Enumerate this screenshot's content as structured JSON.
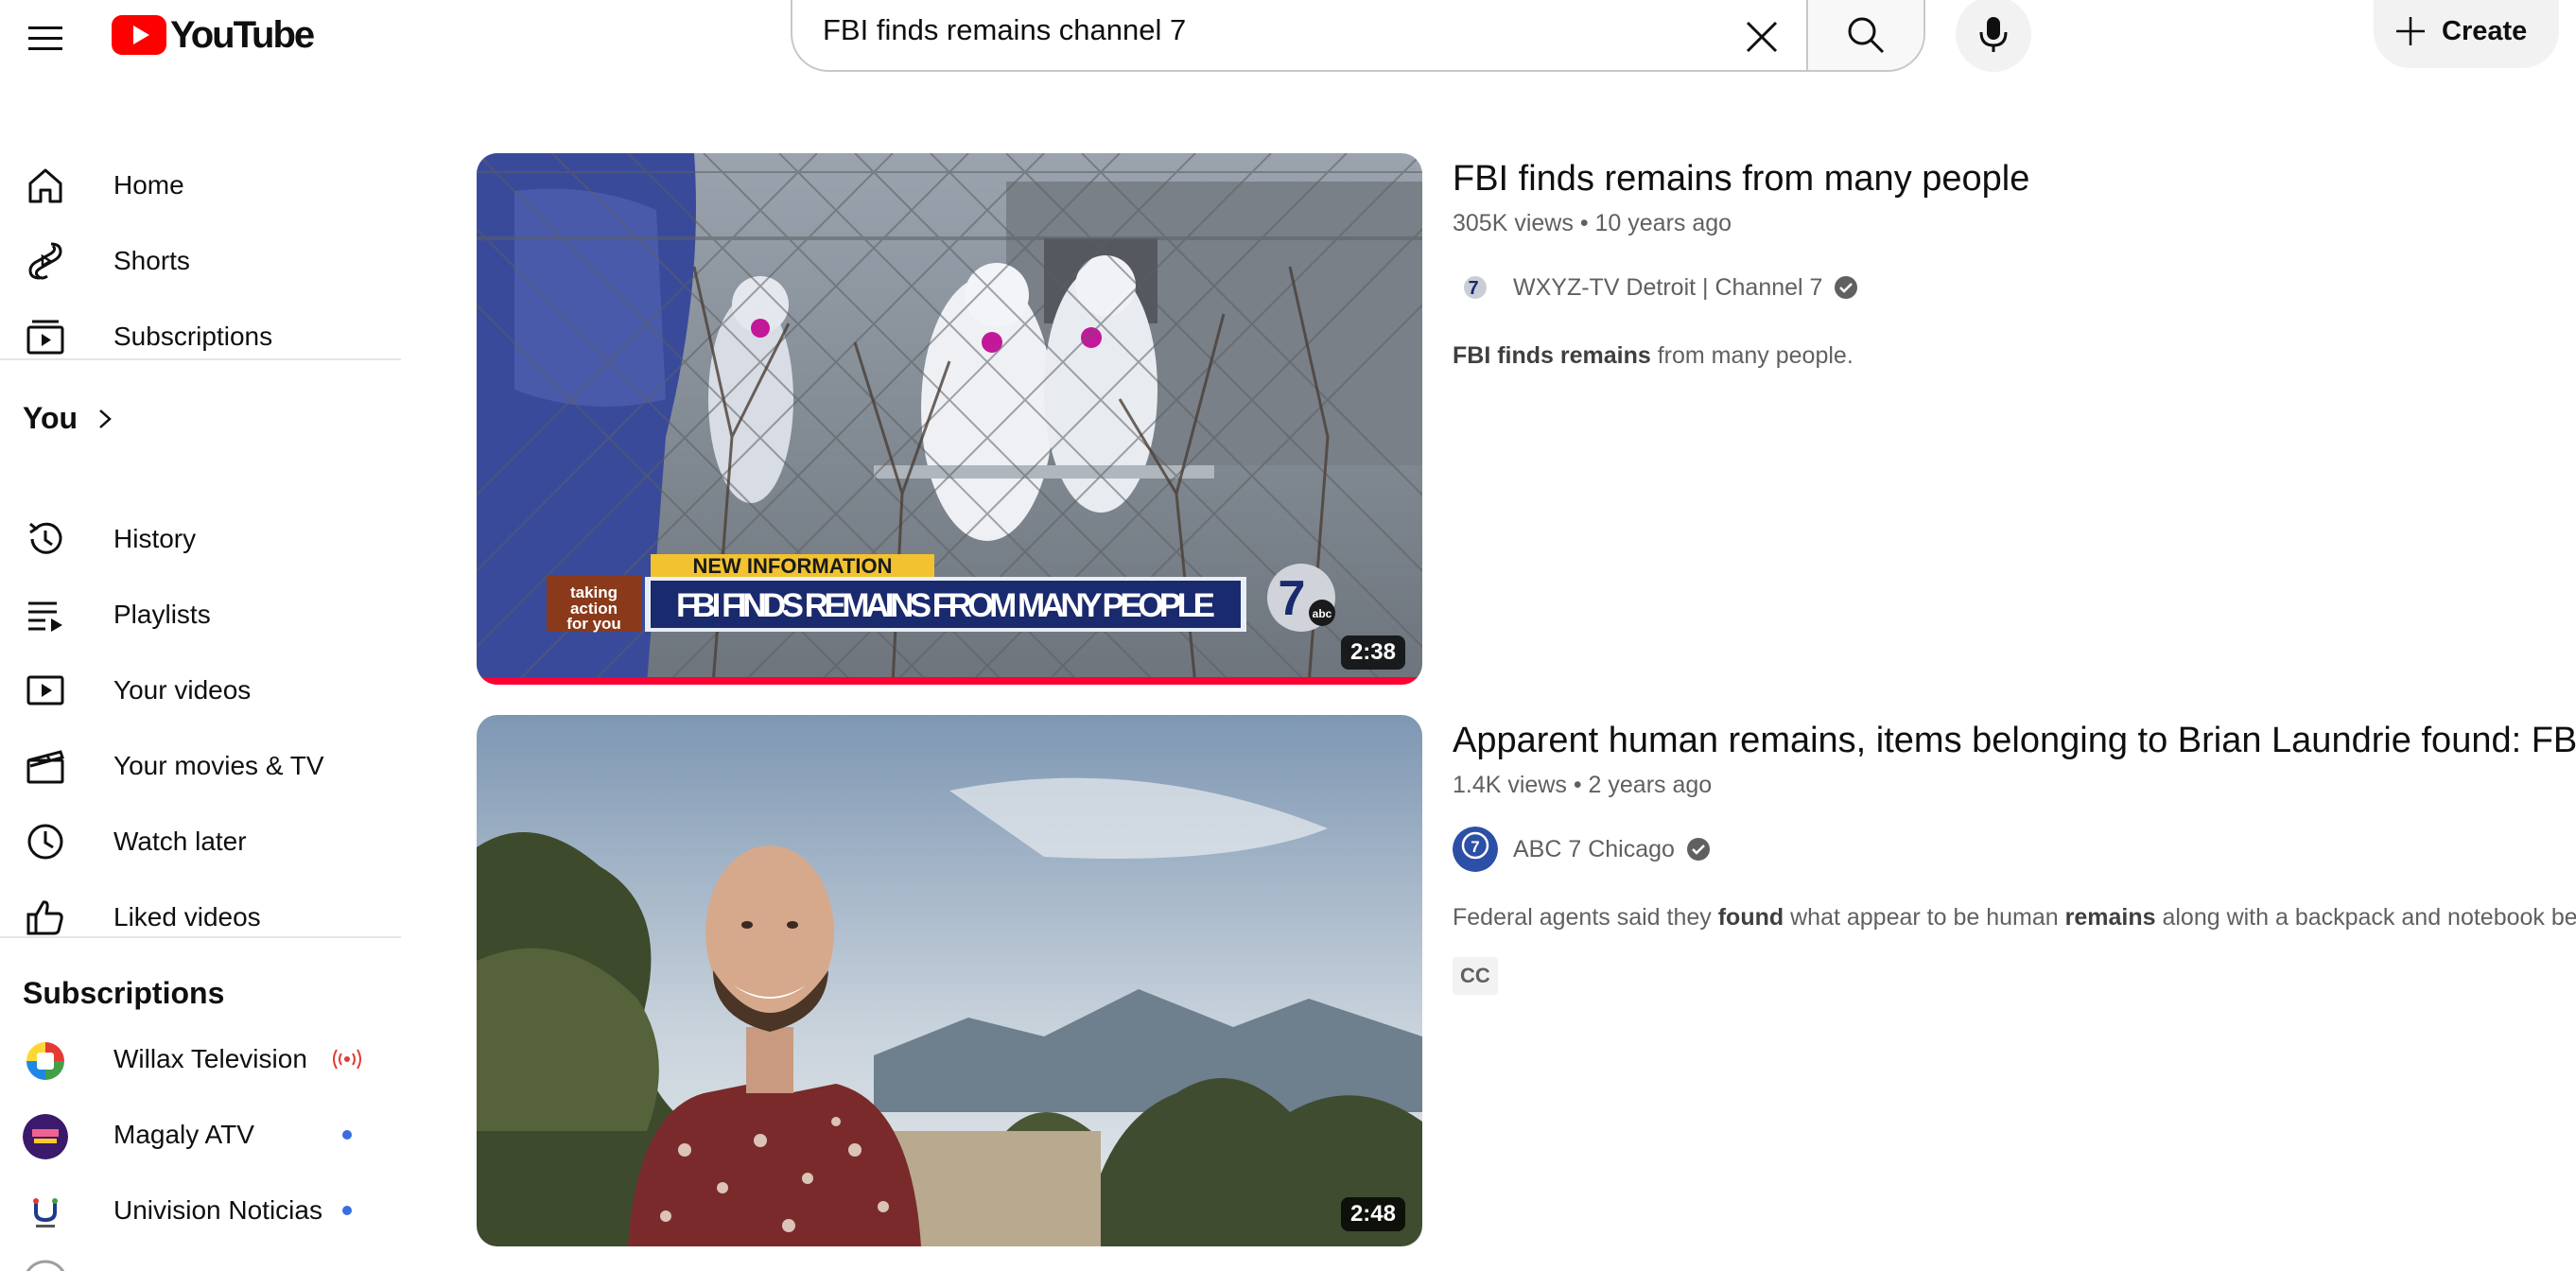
{
  "header": {
    "logo_text": "YouTube",
    "search_value": "FBI finds remains channel 7",
    "create_label": "Create"
  },
  "sidebar": {
    "main_items": [
      {
        "label": "Home",
        "icon": "home-icon"
      },
      {
        "label": "Shorts",
        "icon": "shorts-icon"
      },
      {
        "label": "Subscriptions",
        "icon": "subscriptions-icon"
      }
    ],
    "you_title": "You",
    "you_items": [
      {
        "label": "History",
        "icon": "history-icon"
      },
      {
        "label": "Playlists",
        "icon": "playlists-icon"
      },
      {
        "label": "Your videos",
        "icon": "your-videos-icon"
      },
      {
        "label": "Your movies & TV",
        "icon": "movies-icon"
      },
      {
        "label": "Watch later",
        "icon": "clock-icon"
      },
      {
        "label": "Liked videos",
        "icon": "thumbs-up-icon"
      }
    ],
    "subscriptions_title": "Subscriptions",
    "subscriptions": [
      {
        "label": "Willax Television",
        "status": "live"
      },
      {
        "label": "Magaly ATV",
        "status": "new"
      },
      {
        "label": "Univision Noticias",
        "status": "new"
      }
    ]
  },
  "results": [
    {
      "title": "FBI finds remains from many people",
      "views": "305K views",
      "age": "10 years ago",
      "channel": "WXYZ-TV Detroit | Channel 7",
      "verified": true,
      "desc_bold_1": "FBI finds remains",
      "desc_rest": "from many people.",
      "duration": "2:38",
      "thumb_banner_top": "NEW INFORMATION",
      "thumb_banner_main": "FBI FINDS REMAINS FROM MANY PEOPLE",
      "thumb_tag": "taking action for you"
    },
    {
      "title": "Apparent human remains, items belonging to Brian Laundrie found: FBI",
      "views": "1.4K views",
      "age": "2 years ago",
      "channel": "ABC 7 Chicago",
      "verified": true,
      "desc_part_1": "Federal agents said they",
      "desc_bold_1": "found",
      "desc_part_2": "what appear to be human",
      "desc_bold_2": "remains",
      "desc_part_3": "along with a backpack and notebook belongin",
      "badge": "CC",
      "duration": "2:48"
    }
  ],
  "colors": {
    "brand_red": "#ff0000",
    "progress_red": "#ff0033",
    "verified_gray": "#606060",
    "new_dot_blue": "#3a6de0"
  }
}
